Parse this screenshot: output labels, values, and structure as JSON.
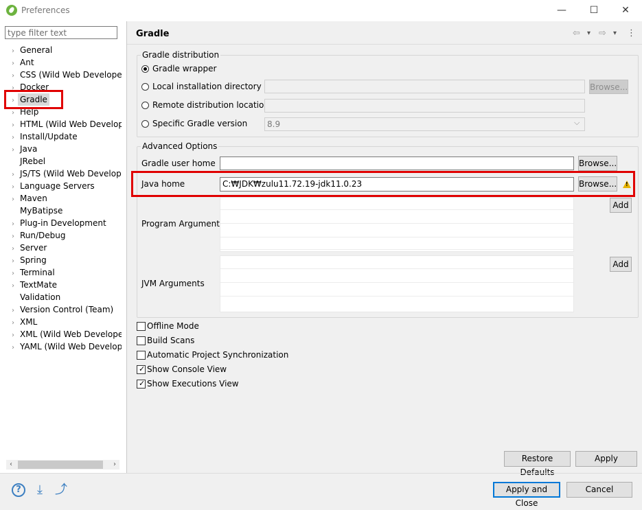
{
  "window": {
    "title": "Preferences",
    "minimize": "—",
    "maximize": "☐",
    "close": "✕"
  },
  "sidebar": {
    "filter_placeholder": "type filter text",
    "items": [
      {
        "label": "General",
        "arrow": "›"
      },
      {
        "label": "Ant",
        "arrow": "›"
      },
      {
        "label": "CSS (Wild Web Developer)",
        "arrow": "›"
      },
      {
        "label": "Docker",
        "arrow": "›"
      },
      {
        "label": "Gradle",
        "arrow": "›"
      },
      {
        "label": "Help",
        "arrow": "›"
      },
      {
        "label": "HTML (Wild Web Developer)",
        "arrow": "›"
      },
      {
        "label": "Install/Update",
        "arrow": "›"
      },
      {
        "label": "Java",
        "arrow": "›"
      },
      {
        "label": "JRebel",
        "arrow": ""
      },
      {
        "label": "JS/TS (Wild Web Developer)",
        "arrow": "›"
      },
      {
        "label": "Language Servers",
        "arrow": "›"
      },
      {
        "label": "Maven",
        "arrow": "›"
      },
      {
        "label": "MyBatipse",
        "arrow": ""
      },
      {
        "label": "Plug-in Development",
        "arrow": "›"
      },
      {
        "label": "Run/Debug",
        "arrow": "›"
      },
      {
        "label": "Server",
        "arrow": "›"
      },
      {
        "label": "Spring",
        "arrow": "›"
      },
      {
        "label": "Terminal",
        "arrow": "›"
      },
      {
        "label": "TextMate",
        "arrow": "›"
      },
      {
        "label": "Validation",
        "arrow": ""
      },
      {
        "label": "Version Control (Team)",
        "arrow": "›"
      },
      {
        "label": "XML",
        "arrow": "›"
      },
      {
        "label": "XML (Wild Web Developer)",
        "arrow": "›"
      },
      {
        "label": "YAML (Wild Web Developer)",
        "arrow": "›"
      }
    ],
    "scroll_left": "‹",
    "scroll_right": "›"
  },
  "page": {
    "title": "Gradle",
    "nav": {
      "back": "⇦",
      "back_menu": "▾",
      "forward": "⇨",
      "forward_menu": "▾",
      "more": "⋮"
    }
  },
  "distribution": {
    "title": "Gradle distribution",
    "wrapper_label": "Gradle wrapper",
    "local_label": "Local installation directory",
    "local_value": "",
    "browse_label": "Browse...",
    "remote_label": "Remote distribution location",
    "remote_value": "",
    "specific_label": "Specific Gradle version",
    "specific_value": "8.9",
    "dropdown_arrow": "⌵"
  },
  "advanced": {
    "title": "Advanced Options",
    "user_home_label": "Gradle user home",
    "user_home_value": "",
    "browse_label": "Browse...",
    "java_home_label": "Java home",
    "java_home_value": "C:₩JDK₩zulu11.72.19-jdk11.0.23",
    "java_home_browse": "Browse...",
    "warning_mark": "!",
    "program_args_label": "Program Arguments",
    "jvm_args_label": "JVM Arguments",
    "add_label": "Add"
  },
  "options": {
    "offline": {
      "label": "Offline Mode",
      "checked": false
    },
    "build_scans": {
      "label": "Build Scans",
      "checked": false
    },
    "auto_sync": {
      "label": "Automatic Project Synchronization",
      "checked": false
    },
    "console": {
      "label": "Show Console View",
      "checked": true
    },
    "executions": {
      "label": "Show Executions View",
      "checked": true
    },
    "check_glyph": "✓"
  },
  "footer": {
    "restore_defaults": "Restore Defaults",
    "apply": "Apply",
    "apply_and_close": "Apply and Close",
    "cancel": "Cancel",
    "help_icon": "?",
    "import_icon": "⤓",
    "export_icon": "⤴"
  },
  "colors": {
    "highlight_red": "#e00000",
    "default_button_border": "#0078d7",
    "warning_yellow": "#e8b400"
  }
}
